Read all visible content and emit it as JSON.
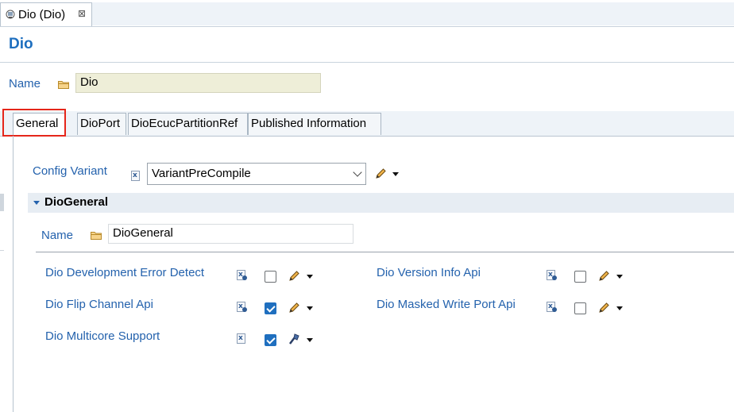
{
  "editor_tab": {
    "title": "Dio (Dio)",
    "close_symbol": "⊠"
  },
  "page_title": "Dio",
  "name_field": {
    "label": "Name",
    "value": "Dio"
  },
  "tabs": [
    {
      "label": "General",
      "active": true
    },
    {
      "label": "DioPort",
      "active": false
    },
    {
      "label": "DioEcucPartitionRef",
      "active": false
    },
    {
      "label": "Published Information",
      "active": false
    }
  ],
  "config_variant": {
    "label": "Config Variant",
    "value": "VariantPreCompile"
  },
  "section": {
    "title": "DioGeneral",
    "name_label": "Name",
    "name_value": "DioGeneral"
  },
  "params": [
    {
      "label": "Dio Development Error Detect",
      "checked": false
    },
    {
      "label": "Dio Version Info Api",
      "checked": false
    },
    {
      "label": "Dio Flip Channel Api",
      "checked": true
    },
    {
      "label": "Dio Masked Write Port Api",
      "checked": false
    },
    {
      "label": "Dio Multicore Support",
      "checked": true
    }
  ],
  "colors": {
    "link": "#2462ad",
    "title": "#1e6fbf",
    "highlight": "#e5261a",
    "name_field_bg": "#eeeed8"
  },
  "icons": [
    "editor-icon",
    "close-icon",
    "folder-icon",
    "variant-doc-icon",
    "param-doc-icon",
    "pencil-icon",
    "dropdown-arrow-icon",
    "chevron-down-icon",
    "wand-icon",
    "collapse-triangle-icon"
  ]
}
